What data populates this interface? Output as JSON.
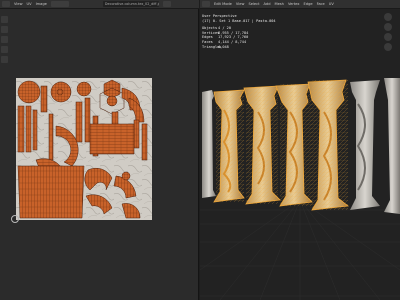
{
  "uv_editor": {
    "menus": [
      "View",
      "UV",
      "Image"
    ],
    "image_name": "Decorative.column.tex_02_diff.jpg.001"
  },
  "viewport": {
    "mode": "Edit Mode",
    "menus": [
      "View",
      "Select",
      "Add",
      "Mesh",
      "Vertex",
      "Edge",
      "Face",
      "UV"
    ],
    "view_name": "User Perspective",
    "object_name": "(17) 0. Set 1 Base.017 | Pasta.004",
    "stats": [
      {
        "label": "Objects",
        "value": "4 / 20"
      },
      {
        "label": "Vertices",
        "value": "8,955 / 17,784"
      },
      {
        "label": "Edges",
        "value": "17,923 / 7,760"
      },
      {
        "label": "Faces",
        "value": "4,144 / 8,744"
      },
      {
        "label": "Triangles",
        "value": "4,048"
      }
    ]
  },
  "colors": {
    "uv_island": "#c8622a",
    "uv_edge": "#4a1d0a",
    "texture": "#cfcac2",
    "selected_wire": "#e8a23a",
    "column": "#bdbab4"
  }
}
